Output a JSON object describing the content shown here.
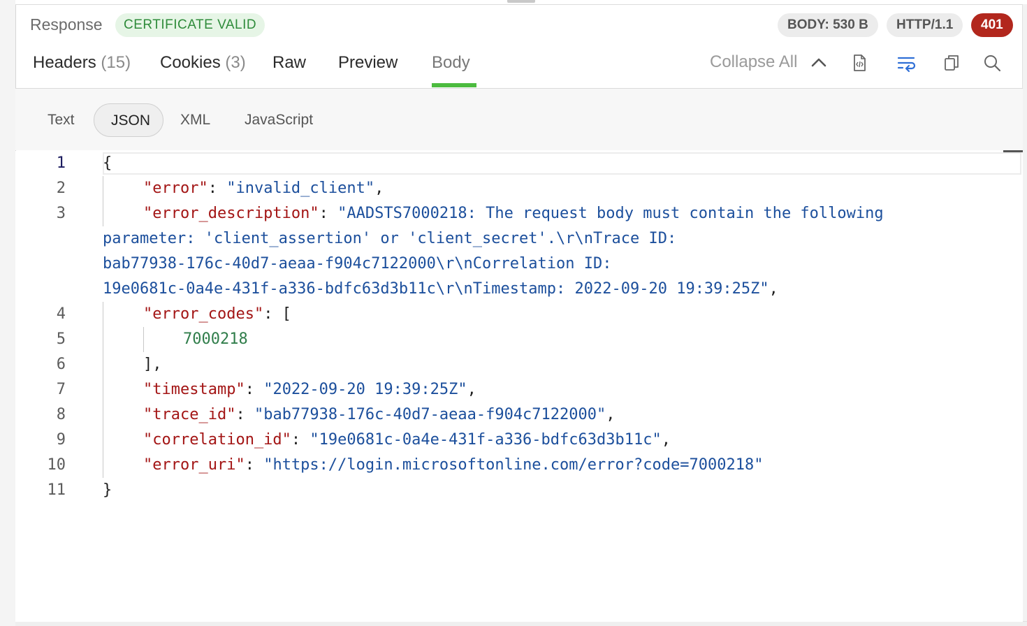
{
  "response": {
    "title": "Response",
    "certificate": "CERTIFICATE VALID",
    "body_size": "BODY: 530 B",
    "protocol": "HTTP/1.1",
    "status_code": "401",
    "status_color": "#b2271d"
  },
  "tabs": [
    {
      "label": "Headers",
      "count": "(15)"
    },
    {
      "label": "Cookies",
      "count": "(3)"
    },
    {
      "label": "Raw",
      "count": ""
    },
    {
      "label": "Preview",
      "count": ""
    },
    {
      "label": "Body",
      "count": "",
      "active": true
    }
  ],
  "toolbar": {
    "collapse_all": "Collapse All",
    "icons": [
      "chevron-up-icon",
      "code-file-icon",
      "wrap-lines-icon",
      "copy-icon",
      "search-icon"
    ]
  },
  "formats": {
    "text": "Text",
    "json": "JSON",
    "xml": "XML",
    "javascript": "JavaScript",
    "selected": "JSON"
  },
  "code": {
    "line_numbers": [
      "1",
      "2",
      "3",
      "4",
      "5",
      "6",
      "7",
      "8",
      "9",
      "10",
      "11"
    ],
    "open_brace": "{",
    "close_brace": "}",
    "error_key": "\"error\"",
    "error_val": "\"invalid_client\"",
    "desc_key": "\"error_description\"",
    "desc_val_1": "\"AADSTS7000218: The request body must contain the following",
    "desc_val_2": "parameter: 'client_assertion' or 'client_secret'.\\r\\nTrace ID:",
    "desc_val_3": "bab77938-176c-40d7-aeaa-f904c7122000\\r\\nCorrelation ID:",
    "desc_val_4": "19e0681c-0a4e-431f-a336-bdfc63d3b11c\\r\\nTimestamp: 2022-09-20 19:39:25Z\"",
    "codes_key": "\"error_codes\"",
    "codes_val": "7000218",
    "timestamp_key": "\"timestamp\"",
    "timestamp_val": "\"2022-09-20 19:39:25Z\"",
    "trace_key": "\"trace_id\"",
    "trace_val": "\"bab77938-176c-40d7-aeaa-f904c7122000\"",
    "corr_key": "\"correlation_id\"",
    "corr_val": "\"19e0681c-0a4e-431f-a336-bdfc63d3b11c\"",
    "uri_key": "\"error_uri\"",
    "uri_val": "\"https://login.microsoftonline.com/error?code=7000218\""
  }
}
